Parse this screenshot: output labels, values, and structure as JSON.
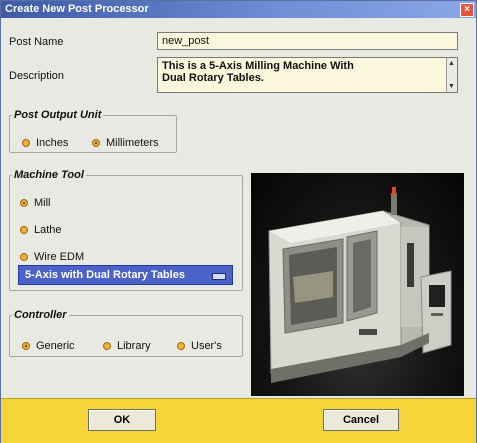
{
  "window": {
    "title": "Create New Post Processor"
  },
  "form": {
    "post_name_label": "Post Name",
    "post_name_value": "new_post",
    "description_label": "Description",
    "description_lines": [
      "This is a 5-Axis Milling Machine With",
      "Dual Rotary Tables."
    ]
  },
  "post_output_unit": {
    "label": "Post Output Unit",
    "options": [
      "Inches",
      "Millimeters"
    ],
    "selected": "Millimeters"
  },
  "machine_tool": {
    "label": "Machine Tool",
    "options": [
      "Mill",
      "Lathe",
      "Wire EDM"
    ],
    "selected": "Mill",
    "config_value": "5-Axis with Dual Rotary Tables"
  },
  "controller": {
    "label": "Controller",
    "options": [
      "Generic",
      "Library",
      "User's"
    ],
    "selected": "Generic"
  },
  "buttons": {
    "ok": "OK",
    "cancel": "Cancel"
  },
  "colors": {
    "title_bar": "#3c5aa8",
    "field_bg": "#fbf7dc",
    "dropdown": "#4b63c9",
    "radio": "#f0b030",
    "bottom_bar": "#f5d53a"
  },
  "icons": {
    "close": "close-icon",
    "scroll_up": "arrow-up-icon",
    "scroll_down": "arrow-down-icon",
    "dropdown": "dropdown-icon"
  }
}
